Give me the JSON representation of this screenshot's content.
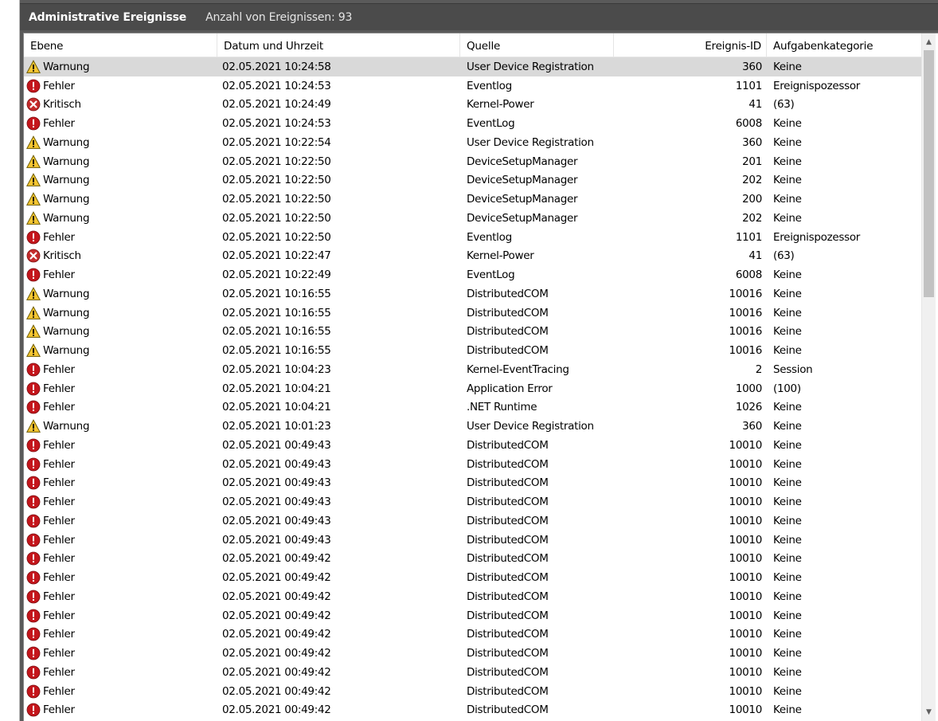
{
  "title": {
    "main": "Administrative Ereignisse",
    "count": "Anzahl von Ereignissen: 93"
  },
  "columns": {
    "level": "Ebene",
    "date": "Datum und Uhrzeit",
    "source": "Quelle",
    "event_id": "Ereignis-ID",
    "category": "Aufgabenkategorie"
  },
  "icons": {
    "warning": "warning-icon",
    "error": "error-icon",
    "critical": "critical-icon"
  },
  "colors": {
    "selected_row": "#d9d9d9",
    "title_bar": "#4b4b4b",
    "warning": "#f4c531",
    "error": "#c4161c",
    "critical": "#c42b2b"
  },
  "rows": [
    {
      "level": "Warnung",
      "type": "warning",
      "date": "02.05.2021 10:24:58",
      "source": "User Device Registration",
      "id": "360",
      "category": "Keine",
      "selected": true
    },
    {
      "level": "Fehler",
      "type": "error",
      "date": "02.05.2021 10:24:53",
      "source": "Eventlog",
      "id": "1101",
      "category": "Ereignispozessor"
    },
    {
      "level": "Kritisch",
      "type": "critical",
      "date": "02.05.2021 10:24:49",
      "source": "Kernel-Power",
      "id": "41",
      "category": "(63)"
    },
    {
      "level": "Fehler",
      "type": "error",
      "date": "02.05.2021 10:24:53",
      "source": "EventLog",
      "id": "6008",
      "category": "Keine"
    },
    {
      "level": "Warnung",
      "type": "warning",
      "date": "02.05.2021 10:22:54",
      "source": "User Device Registration",
      "id": "360",
      "category": "Keine"
    },
    {
      "level": "Warnung",
      "type": "warning",
      "date": "02.05.2021 10:22:50",
      "source": "DeviceSetupManager",
      "id": "201",
      "category": "Keine"
    },
    {
      "level": "Warnung",
      "type": "warning",
      "date": "02.05.2021 10:22:50",
      "source": "DeviceSetupManager",
      "id": "202",
      "category": "Keine"
    },
    {
      "level": "Warnung",
      "type": "warning",
      "date": "02.05.2021 10:22:50",
      "source": "DeviceSetupManager",
      "id": "200",
      "category": "Keine"
    },
    {
      "level": "Warnung",
      "type": "warning",
      "date": "02.05.2021 10:22:50",
      "source": "DeviceSetupManager",
      "id": "202",
      "category": "Keine"
    },
    {
      "level": "Fehler",
      "type": "error",
      "date": "02.05.2021 10:22:50",
      "source": "Eventlog",
      "id": "1101",
      "category": "Ereignispozessor"
    },
    {
      "level": "Kritisch",
      "type": "critical",
      "date": "02.05.2021 10:22:47",
      "source": "Kernel-Power",
      "id": "41",
      "category": "(63)"
    },
    {
      "level": "Fehler",
      "type": "error",
      "date": "02.05.2021 10:22:49",
      "source": "EventLog",
      "id": "6008",
      "category": "Keine"
    },
    {
      "level": "Warnung",
      "type": "warning",
      "date": "02.05.2021 10:16:55",
      "source": "DistributedCOM",
      "id": "10016",
      "category": "Keine"
    },
    {
      "level": "Warnung",
      "type": "warning",
      "date": "02.05.2021 10:16:55",
      "source": "DistributedCOM",
      "id": "10016",
      "category": "Keine"
    },
    {
      "level": "Warnung",
      "type": "warning",
      "date": "02.05.2021 10:16:55",
      "source": "DistributedCOM",
      "id": "10016",
      "category": "Keine"
    },
    {
      "level": "Warnung",
      "type": "warning",
      "date": "02.05.2021 10:16:55",
      "source": "DistributedCOM",
      "id": "10016",
      "category": "Keine"
    },
    {
      "level": "Fehler",
      "type": "error",
      "date": "02.05.2021 10:04:23",
      "source": "Kernel-EventTracing",
      "id": "2",
      "category": "Session"
    },
    {
      "level": "Fehler",
      "type": "error",
      "date": "02.05.2021 10:04:21",
      "source": "Application Error",
      "id": "1000",
      "category": "(100)"
    },
    {
      "level": "Fehler",
      "type": "error",
      "date": "02.05.2021 10:04:21",
      "source": ".NET Runtime",
      "id": "1026",
      "category": "Keine"
    },
    {
      "level": "Warnung",
      "type": "warning",
      "date": "02.05.2021 10:01:23",
      "source": "User Device Registration",
      "id": "360",
      "category": "Keine"
    },
    {
      "level": "Fehler",
      "type": "error",
      "date": "02.05.2021 00:49:43",
      "source": "DistributedCOM",
      "id": "10010",
      "category": "Keine"
    },
    {
      "level": "Fehler",
      "type": "error",
      "date": "02.05.2021 00:49:43",
      "source": "DistributedCOM",
      "id": "10010",
      "category": "Keine"
    },
    {
      "level": "Fehler",
      "type": "error",
      "date": "02.05.2021 00:49:43",
      "source": "DistributedCOM",
      "id": "10010",
      "category": "Keine"
    },
    {
      "level": "Fehler",
      "type": "error",
      "date": "02.05.2021 00:49:43",
      "source": "DistributedCOM",
      "id": "10010",
      "category": "Keine"
    },
    {
      "level": "Fehler",
      "type": "error",
      "date": "02.05.2021 00:49:43",
      "source": "DistributedCOM",
      "id": "10010",
      "category": "Keine"
    },
    {
      "level": "Fehler",
      "type": "error",
      "date": "02.05.2021 00:49:43",
      "source": "DistributedCOM",
      "id": "10010",
      "category": "Keine"
    },
    {
      "level": "Fehler",
      "type": "error",
      "date": "02.05.2021 00:49:42",
      "source": "DistributedCOM",
      "id": "10010",
      "category": "Keine"
    },
    {
      "level": "Fehler",
      "type": "error",
      "date": "02.05.2021 00:49:42",
      "source": "DistributedCOM",
      "id": "10010",
      "category": "Keine"
    },
    {
      "level": "Fehler",
      "type": "error",
      "date": "02.05.2021 00:49:42",
      "source": "DistributedCOM",
      "id": "10010",
      "category": "Keine"
    },
    {
      "level": "Fehler",
      "type": "error",
      "date": "02.05.2021 00:49:42",
      "source": "DistributedCOM",
      "id": "10010",
      "category": "Keine"
    },
    {
      "level": "Fehler",
      "type": "error",
      "date": "02.05.2021 00:49:42",
      "source": "DistributedCOM",
      "id": "10010",
      "category": "Keine"
    },
    {
      "level": "Fehler",
      "type": "error",
      "date": "02.05.2021 00:49:42",
      "source": "DistributedCOM",
      "id": "10010",
      "category": "Keine"
    },
    {
      "level": "Fehler",
      "type": "error",
      "date": "02.05.2021 00:49:42",
      "source": "DistributedCOM",
      "id": "10010",
      "category": "Keine"
    },
    {
      "level": "Fehler",
      "type": "error",
      "date": "02.05.2021 00:49:42",
      "source": "DistributedCOM",
      "id": "10010",
      "category": "Keine"
    },
    {
      "level": "Fehler",
      "type": "error",
      "date": "02.05.2021 00:49:42",
      "source": "DistributedCOM",
      "id": "10010",
      "category": "Keine"
    }
  ]
}
